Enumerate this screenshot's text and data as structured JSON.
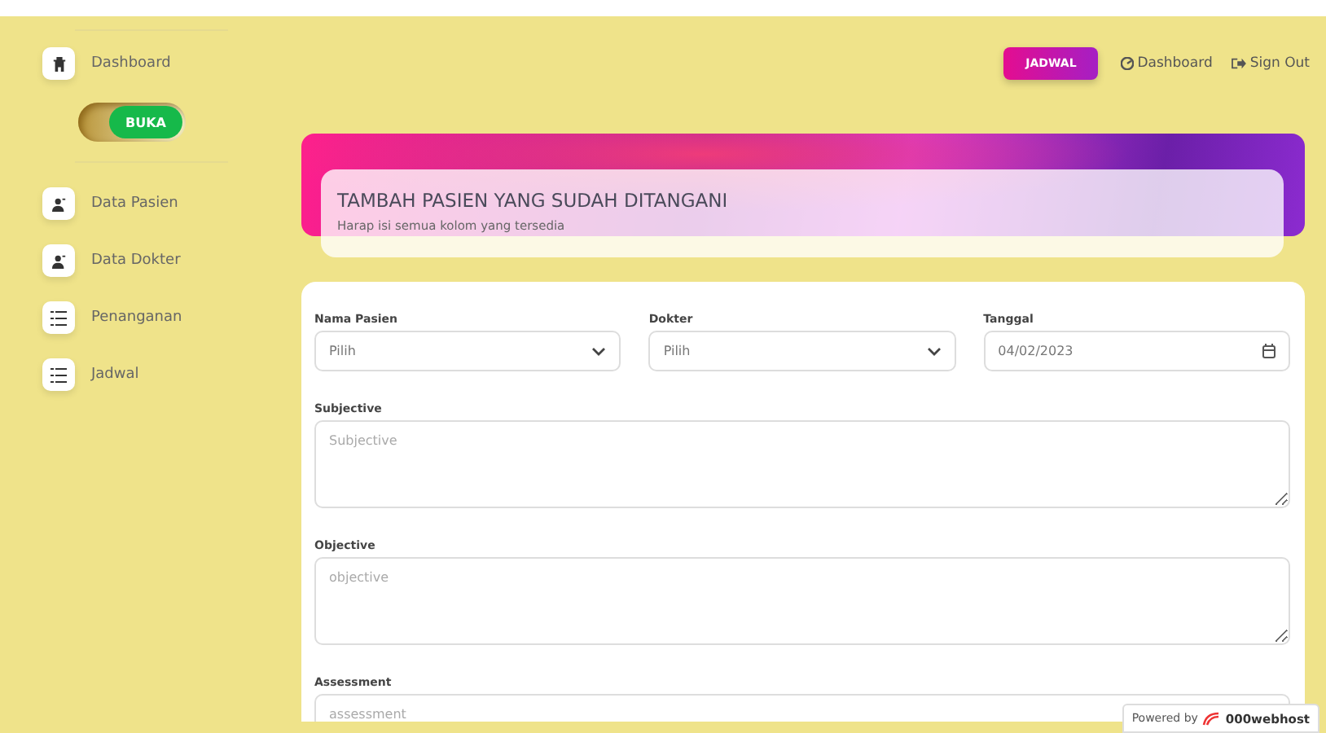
{
  "sidebar": {
    "items": [
      {
        "label": "Dashboard",
        "kind": "home",
        "selected": false
      },
      {
        "label": "Data Pasien",
        "kind": "people",
        "selected": false
      },
      {
        "label": "Data Dokter",
        "kind": "people",
        "selected": false
      },
      {
        "label": "Penanganan",
        "kind": "list",
        "selected": false
      },
      {
        "label": "Jadwal",
        "kind": "list",
        "selected": false
      }
    ],
    "toggle": {
      "label": "BUKA",
      "on": true
    }
  },
  "top_nav": {
    "button": "JADWAL",
    "links": [
      {
        "label": "Dashboard"
      },
      {
        "label": "Sign Out"
      }
    ]
  },
  "header": {
    "title": "TAMBAH PASIEN YANG SUDAH DITANGANI",
    "subtitle": "Harap isi semua kolom yang tersedia"
  },
  "form": {
    "row": [
      {
        "label": "Nama Pasien",
        "kind": "select",
        "value": "Pilih"
      },
      {
        "label": "Dokter",
        "kind": "select",
        "value": "Pilih"
      },
      {
        "label": "Tanggal",
        "kind": "date",
        "value": "04/02/2023"
      }
    ],
    "areas": [
      {
        "label": "Subjective",
        "placeholder": "Subjective"
      },
      {
        "label": "Objective",
        "placeholder": "objective"
      },
      {
        "label": "Assessment",
        "placeholder": "assessment"
      }
    ]
  },
  "badge": {
    "prefix": "Powered by",
    "brand": "000webhost"
  }
}
